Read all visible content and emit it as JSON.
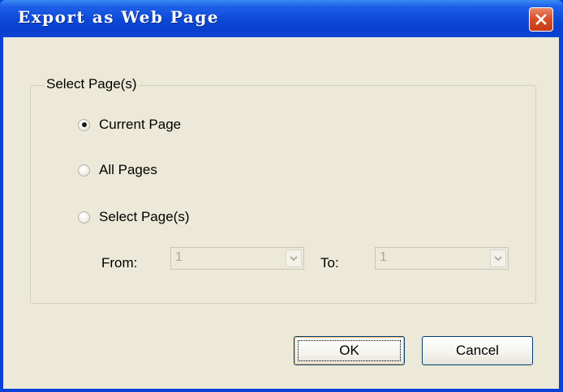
{
  "window": {
    "title": "Export as Web Page",
    "close_icon": "close-icon"
  },
  "group": {
    "label": "Select Page(s)",
    "options": [
      {
        "label": "Current Page",
        "selected": true
      },
      {
        "label": "All Pages",
        "selected": false
      },
      {
        "label": "Select Page(s)",
        "selected": false
      }
    ]
  },
  "range": {
    "from_label": "From:",
    "from_value": "1",
    "to_label": "To:",
    "to_value": "1",
    "enabled": false
  },
  "buttons": {
    "ok_label": "OK",
    "cancel_label": "Cancel"
  },
  "colors": {
    "titlebar": "#0a3fd8",
    "dialog_background": "#ece9d8",
    "close_button": "#d9502a"
  }
}
